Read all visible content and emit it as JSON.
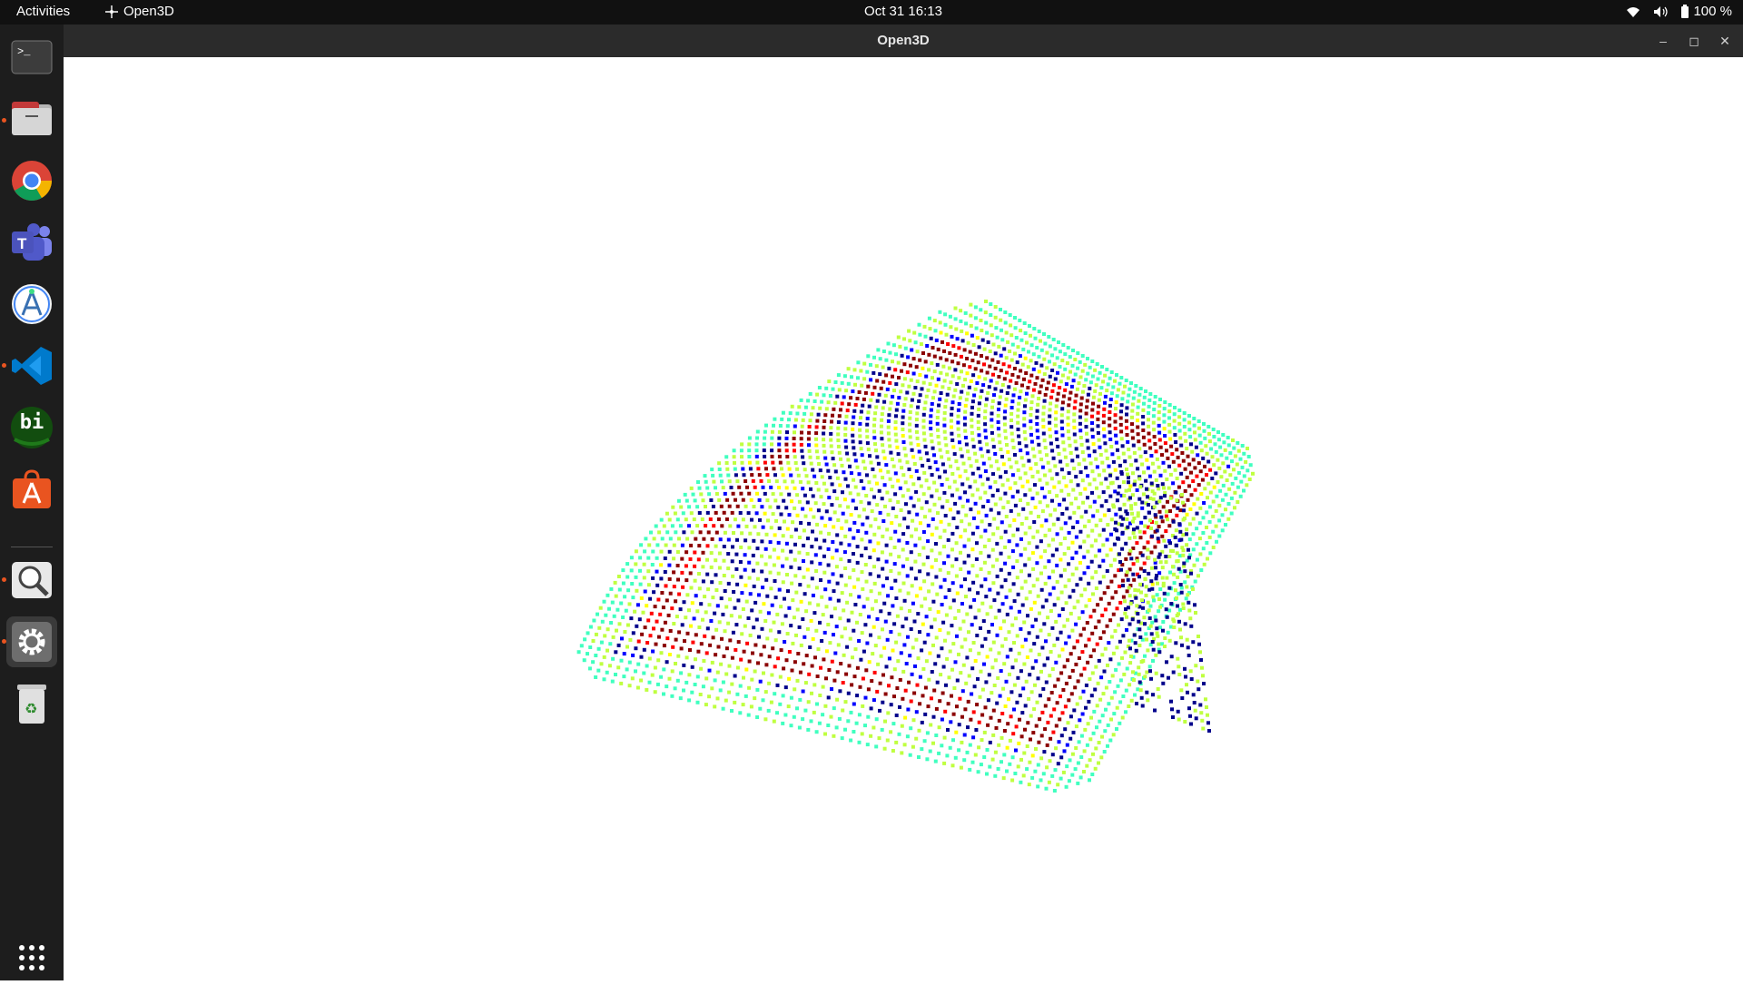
{
  "topbar": {
    "activities": "Activities",
    "app_name": "Open3D",
    "clock": "Oct 31  16:13",
    "battery": "100 %"
  },
  "window": {
    "title": "Open3D",
    "minimize_icon": "minimize-icon",
    "maximize_icon": "maximize-icon",
    "close_icon": "close-icon"
  },
  "dock": {
    "items": [
      {
        "name": "terminal",
        "icon": "terminal-icon",
        "running": false
      },
      {
        "name": "files",
        "icon": "folder-icon",
        "running": true
      },
      {
        "name": "chrome",
        "icon": "chrome-icon",
        "running": false
      },
      {
        "name": "teams",
        "icon": "teams-icon",
        "running": false
      },
      {
        "name": "android-studio",
        "icon": "android-studio-icon",
        "running": false
      },
      {
        "name": "vscode",
        "icon": "vscode-icon",
        "running": true
      },
      {
        "name": "bi",
        "icon": "bi-icon",
        "label": "bi",
        "running": false
      },
      {
        "name": "software",
        "icon": "app-store-icon",
        "running": false
      },
      {
        "name": "image-viewer",
        "icon": "magnifier-icon",
        "running": true
      },
      {
        "name": "settings",
        "icon": "gear-icon",
        "running": true,
        "active": true
      },
      {
        "name": "trash",
        "icon": "trash-icon",
        "running": false
      }
    ],
    "show_apps_icon": "grid-icon"
  },
  "point_cloud": {
    "colormap": [
      "#00008b",
      "#0000ff",
      "#00bfff",
      "#40ffbf",
      "#bfff40",
      "#ffff00",
      "#ff8000",
      "#ff0000",
      "#8b0000"
    ]
  }
}
